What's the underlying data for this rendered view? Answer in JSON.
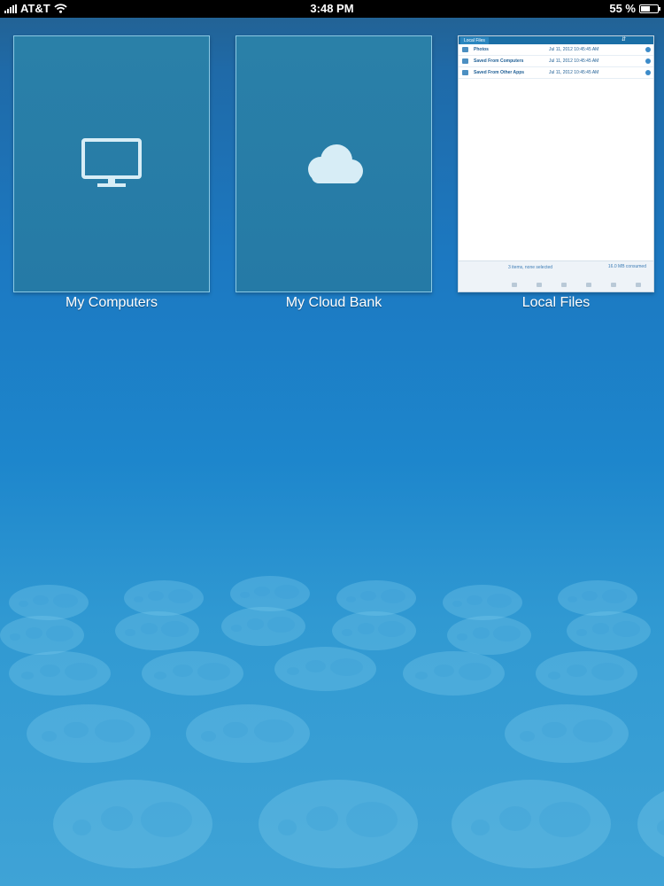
{
  "status_bar": {
    "carrier": "AT&T",
    "time": "3:48 PM",
    "battery_percent_label": "55 %",
    "battery_level": 0.55,
    "signal_bars": 5,
    "wifi_icon": "wifi-icon"
  },
  "tiles": [
    {
      "label": "My Computers",
      "icon": "monitor-icon"
    },
    {
      "label": "My Cloud Bank",
      "icon": "cloud-icon"
    },
    {
      "label": "Local Files",
      "icon": "file-list-preview"
    }
  ],
  "local_files_preview": {
    "tab_label": "Local Files",
    "sort_icon": "sort-icon",
    "rows": [
      {
        "name": "Photos",
        "date": "Jul 11, 2012 10:45:45 AM"
      },
      {
        "name": "Saved From Computers",
        "date": "Jul 11, 2012 10:45:45 AM"
      },
      {
        "name": "Saved From Other Apps",
        "date": "Jul 11, 2012 10:45:45 AM"
      }
    ],
    "footer_count": "3 items, none selected",
    "footer_used": "16.0 MB consumed",
    "toolbar_icons": [
      "back-icon",
      "copy-icon",
      "refresh-icon",
      "edit-icon",
      "trash-icon",
      "menu-icon"
    ]
  },
  "colors": {
    "tile_border": "#96d2eb",
    "background_top": "#23608f",
    "background_bottom": "#3fa3d6"
  }
}
